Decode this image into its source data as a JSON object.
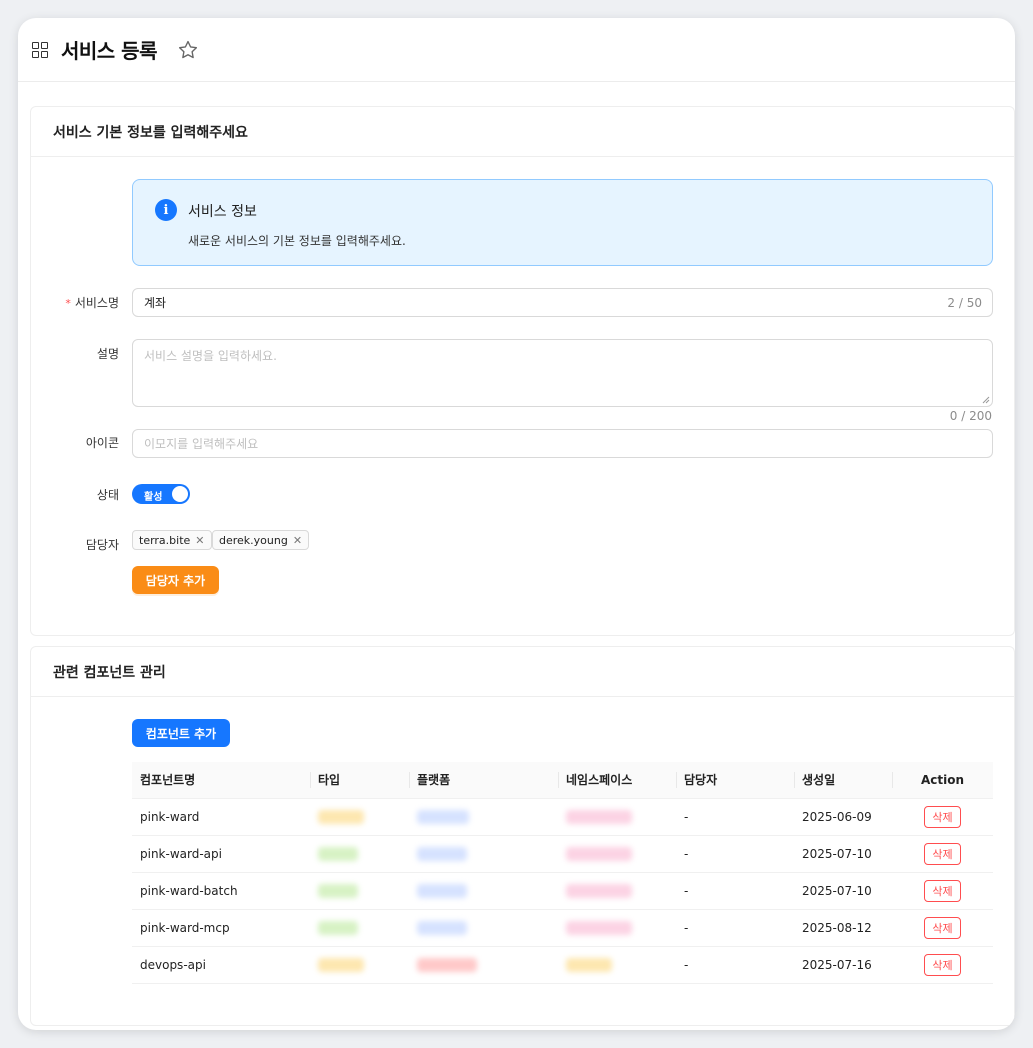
{
  "header": {
    "title": "서비스 등록"
  },
  "basic": {
    "section_title": "서비스 기본 정보를 입력해주세요",
    "alert": {
      "title": "서비스 정보",
      "description": "새로운 서비스의 기본 정보를 입력해주세요."
    },
    "name": {
      "label": "서비스명",
      "required_mark": "*",
      "value": "계좌",
      "counter": "2 / 50"
    },
    "description": {
      "label": "설명",
      "placeholder": "서비스 설명을 입력하세요.",
      "counter": "0 / 200"
    },
    "icon": {
      "label": "아이콘",
      "placeholder": "이모지를 입력해주세요"
    },
    "status": {
      "label": "상태",
      "toggle_text": "활성",
      "on": true
    },
    "owners": {
      "label": "담당자",
      "tags": [
        "terra.bite",
        "derek.young"
      ],
      "add_button": "담당자 추가"
    }
  },
  "components": {
    "section_title": "관련 컴포넌트 관리",
    "add_button": "컴포넌트 추가",
    "columns": [
      "컴포넌트명",
      "타입",
      "플랫폼",
      "네임스페이스",
      "담당자",
      "생성일",
      "Action"
    ],
    "rows": [
      {
        "name": "pink-ward",
        "owner": "-",
        "created": "2025-06-09",
        "action": "삭제"
      },
      {
        "name": "pink-ward-api",
        "owner": "-",
        "created": "2025-07-10",
        "action": "삭제"
      },
      {
        "name": "pink-ward-batch",
        "owner": "-",
        "created": "2025-07-10",
        "action": "삭제"
      },
      {
        "name": "pink-ward-mcp",
        "owner": "-",
        "created": "2025-08-12",
        "action": "삭제"
      },
      {
        "name": "devops-api",
        "owner": "-",
        "created": "2025-07-16",
        "action": "삭제"
      }
    ],
    "blurred_colors": {
      "type": [
        "#fde7b0",
        "#d7f2c4",
        "#d7f2c4",
        "#d7f2c4",
        "#fde7b0"
      ],
      "platform": [
        "#d6e2ff",
        "#d6e2ff",
        "#d6e2ff",
        "#d6e2ff",
        "#ffc9c9"
      ],
      "namespace": [
        "#fcd3e4",
        "#fcd3e4",
        "#fcd3e4",
        "#fcd3e4",
        "#fde7b0"
      ]
    }
  },
  "colors": {
    "primary": "#1677ff",
    "orange": "#fa8c16",
    "danger": "#ff4d4f"
  }
}
